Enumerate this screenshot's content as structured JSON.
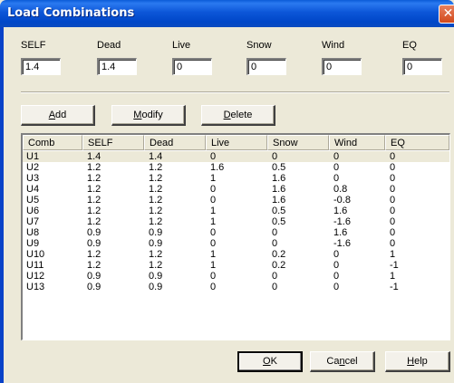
{
  "window": {
    "title": "Load Combinations",
    "close_glyph": "✕"
  },
  "factors": [
    {
      "label": "SELF",
      "value": "1.4"
    },
    {
      "label": "Dead",
      "value": "1.4"
    },
    {
      "label": "Live",
      "value": "0"
    },
    {
      "label": "Snow",
      "value": "0"
    },
    {
      "label": "Wind",
      "value": "0"
    },
    {
      "label": "EQ",
      "value": "0"
    }
  ],
  "actions": {
    "add": {
      "mn": "A",
      "rest": "dd"
    },
    "modify": {
      "mn": "M",
      "rest": "odify"
    },
    "delete": {
      "mn": "D",
      "rest": "elete"
    }
  },
  "table": {
    "columns": [
      "Comb",
      "SELF",
      "Dead",
      "Live",
      "Snow",
      "Wind",
      "EQ"
    ],
    "selected_row": 0,
    "rows": [
      [
        "U1",
        "1.4",
        "1.4",
        "0",
        "0",
        "0",
        "0"
      ],
      [
        "U2",
        "1.2",
        "1.2",
        "1.6",
        "0.5",
        "0",
        "0"
      ],
      [
        "U3",
        "1.2",
        "1.2",
        "1",
        "1.6",
        "0",
        "0"
      ],
      [
        "U4",
        "1.2",
        "1.2",
        "0",
        "1.6",
        "0.8",
        "0"
      ],
      [
        "U5",
        "1.2",
        "1.2",
        "0",
        "1.6",
        "-0.8",
        "0"
      ],
      [
        "U6",
        "1.2",
        "1.2",
        "1",
        "0.5",
        "1.6",
        "0"
      ],
      [
        "U7",
        "1.2",
        "1.2",
        "1",
        "0.5",
        "-1.6",
        "0"
      ],
      [
        "U8",
        "0.9",
        "0.9",
        "0",
        "0",
        "1.6",
        "0"
      ],
      [
        "U9",
        "0.9",
        "0.9",
        "0",
        "0",
        "-1.6",
        "0"
      ],
      [
        "U10",
        "1.2",
        "1.2",
        "1",
        "0.2",
        "0",
        "1"
      ],
      [
        "U11",
        "1.2",
        "1.2",
        "1",
        "0.2",
        "0",
        "-1"
      ],
      [
        "U12",
        "0.9",
        "0.9",
        "0",
        "0",
        "0",
        "1"
      ],
      [
        "U13",
        "0.9",
        "0.9",
        "0",
        "0",
        "0",
        "-1"
      ]
    ]
  },
  "footer": {
    "ok": {
      "mn": "O",
      "rest": "K"
    },
    "cancel": {
      "pre": "Ca",
      "mn": "n",
      "rest": "cel"
    },
    "help": {
      "mn": "H",
      "rest": "elp"
    }
  }
}
